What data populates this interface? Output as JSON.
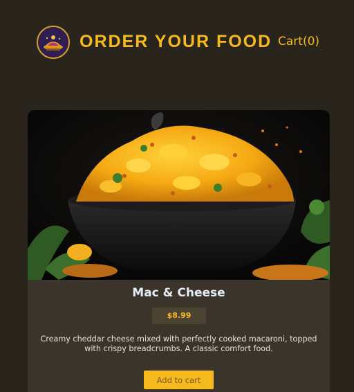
{
  "header": {
    "title": "ORDER YOUR FOOD",
    "cart_label": "Cart(0)",
    "logo_icon": "restaurant-logo-icon"
  },
  "menu": {
    "items": [
      {
        "name": "Mac & Cheese",
        "price": "$8.99",
        "description": "Creamy cheddar cheese mixed with perfectly cooked macaroni, topped with crispy breadcrumbs. A classic comfort food.",
        "add_label": "Add to cart",
        "image_icon": "mac-and-cheese-photo"
      }
    ]
  },
  "colors": {
    "background": "#29251d",
    "accent": "#f6b91e",
    "card": "#3a342a",
    "price_badge": "#4c4332",
    "text_light": "#e4ecf6"
  }
}
